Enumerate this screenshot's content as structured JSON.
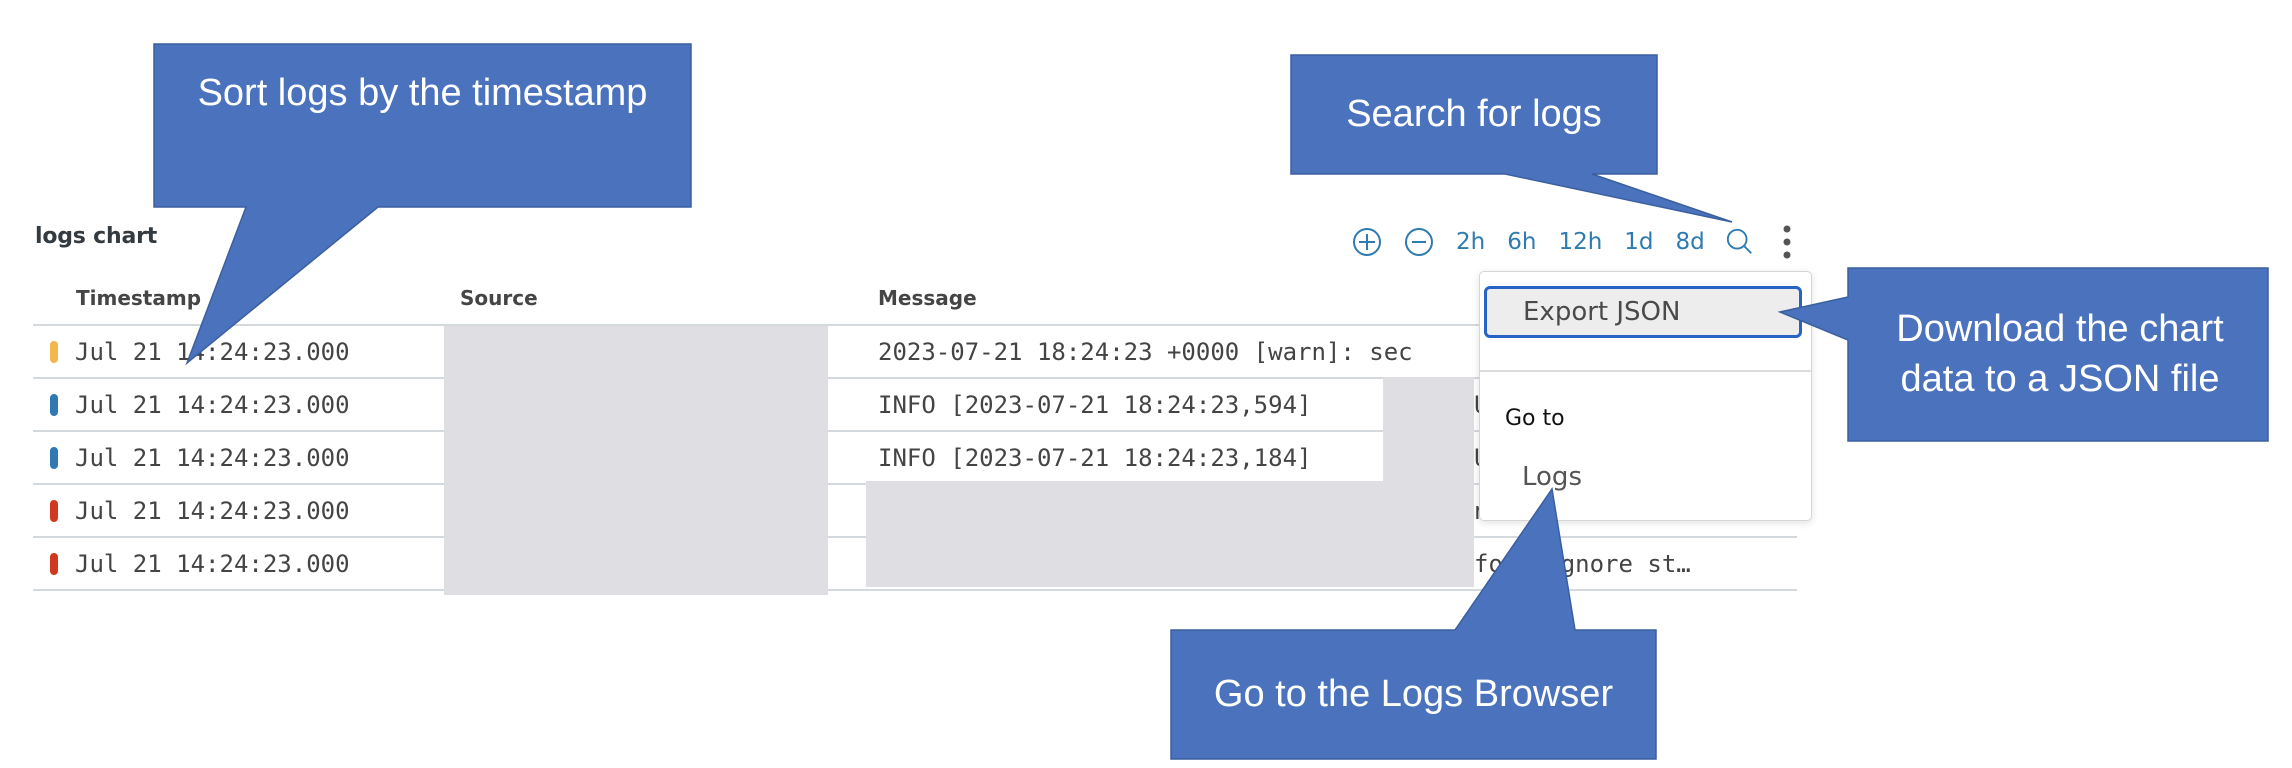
{
  "panel": {
    "title": "logs chart"
  },
  "toolbar": {
    "zoom_in_icon": "plus-circle-icon",
    "zoom_out_icon": "minus-circle-icon",
    "ranges": [
      "2h",
      "6h",
      "12h",
      "1d",
      "8d"
    ],
    "search_icon": "search-icon",
    "more_icon": "kebab-menu-icon"
  },
  "table": {
    "columns": {
      "timestamp": "Timestamp",
      "timestamp_sort": "↓",
      "source": "Source",
      "message": "Message"
    },
    "rows": [
      {
        "severity": "warn",
        "color": "#f2b84b",
        "timestamp": "Jul 21 14:24:23.000",
        "message": "2023-07-21 18:24:23 +0000 [warn]: sec",
        "message_tail": ""
      },
      {
        "severity": "info",
        "color": "#2e78b4",
        "timestamp": "Jul 21 14:24:23.000",
        "message": "INFO [2023-07-21 18:24:23,594]",
        "message_tail": "U"
      },
      {
        "severity": "info",
        "color": "#2e78b4",
        "timestamp": "Jul 21 14:24:23.000",
        "message": "INFO [2023-07-21 18:24:23,184]",
        "message_tail": "U"
      },
      {
        "severity": "error",
        "color": "#d0391f",
        "timestamp": "Jul 21 14:24:23.000",
        "message": "",
        "message_tail": "n"
      },
      {
        "severity": "error",
        "color": "#d0391f",
        "timestamp": "Jul 21 14:24:23.000",
        "message": "",
        "message_tail": "fo   =\"Ignore st…"
      }
    ]
  },
  "menu": {
    "export_label": "Export JSON",
    "section_label": "Go to",
    "logs_label": "Logs"
  },
  "callouts": {
    "sort": "Sort logs by the timestamp",
    "search": "Search for logs",
    "export": "Download the chart data to a JSON file",
    "goto": "Go to the Logs Browser",
    "color": "#4a72bd",
    "border": "#3b5f9f"
  }
}
